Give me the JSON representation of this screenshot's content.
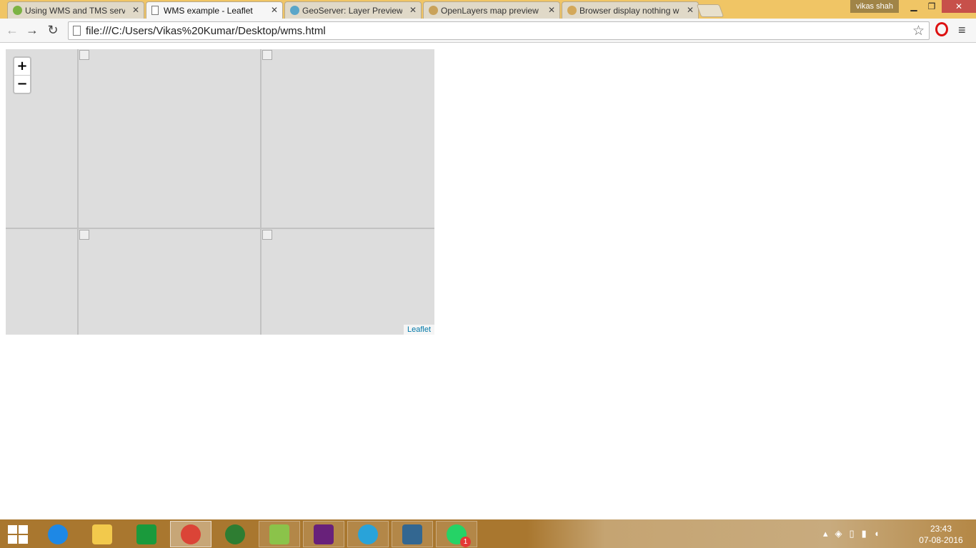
{
  "browser": {
    "tabs": [
      {
        "label": "Using WMS and TMS serv",
        "icon": "leaf-icon",
        "color": "#7cb342",
        "active": false
      },
      {
        "label": "WMS example - Leaflet",
        "icon": "page-icon",
        "color": "#ffffff",
        "active": true
      },
      {
        "label": "GeoServer: Layer Preview",
        "icon": "globe-icon",
        "color": "#5aa6c9",
        "active": false
      },
      {
        "label": "OpenLayers map preview",
        "icon": "openlayers-icon",
        "color": "#c9a25a",
        "active": false
      },
      {
        "label": "Browser display nothing w",
        "icon": "favicon",
        "color": "#d3a85a",
        "active": false
      }
    ],
    "user": "vikas shah",
    "url": "file:///C:/Users/Vikas%20Kumar/Desktop/wms.html"
  },
  "map": {
    "zoom_in": "+",
    "zoom_out": "−",
    "attribution": "Leaflet"
  },
  "taskbar": {
    "apps": [
      {
        "name": "internet-explorer",
        "color": "#1e88e5"
      },
      {
        "name": "file-explorer",
        "color": "#f2c94c"
      },
      {
        "name": "windows-store",
        "color": "#1a9a3c"
      },
      {
        "name": "chrome",
        "color": "#db4437",
        "active": true
      },
      {
        "name": "internet-download-manager",
        "color": "#2e7d32"
      },
      {
        "name": "notepad-plus-plus",
        "color": "#8bc34a"
      },
      {
        "name": "visual-studio",
        "color": "#68217a"
      },
      {
        "name": "app-ring",
        "color": "#29a3d9"
      },
      {
        "name": "postgresql",
        "color": "#336791"
      },
      {
        "name": "whatsapp",
        "color": "#25d366",
        "badge": "1"
      }
    ],
    "time": "23:43",
    "date": "07-08-2016"
  }
}
